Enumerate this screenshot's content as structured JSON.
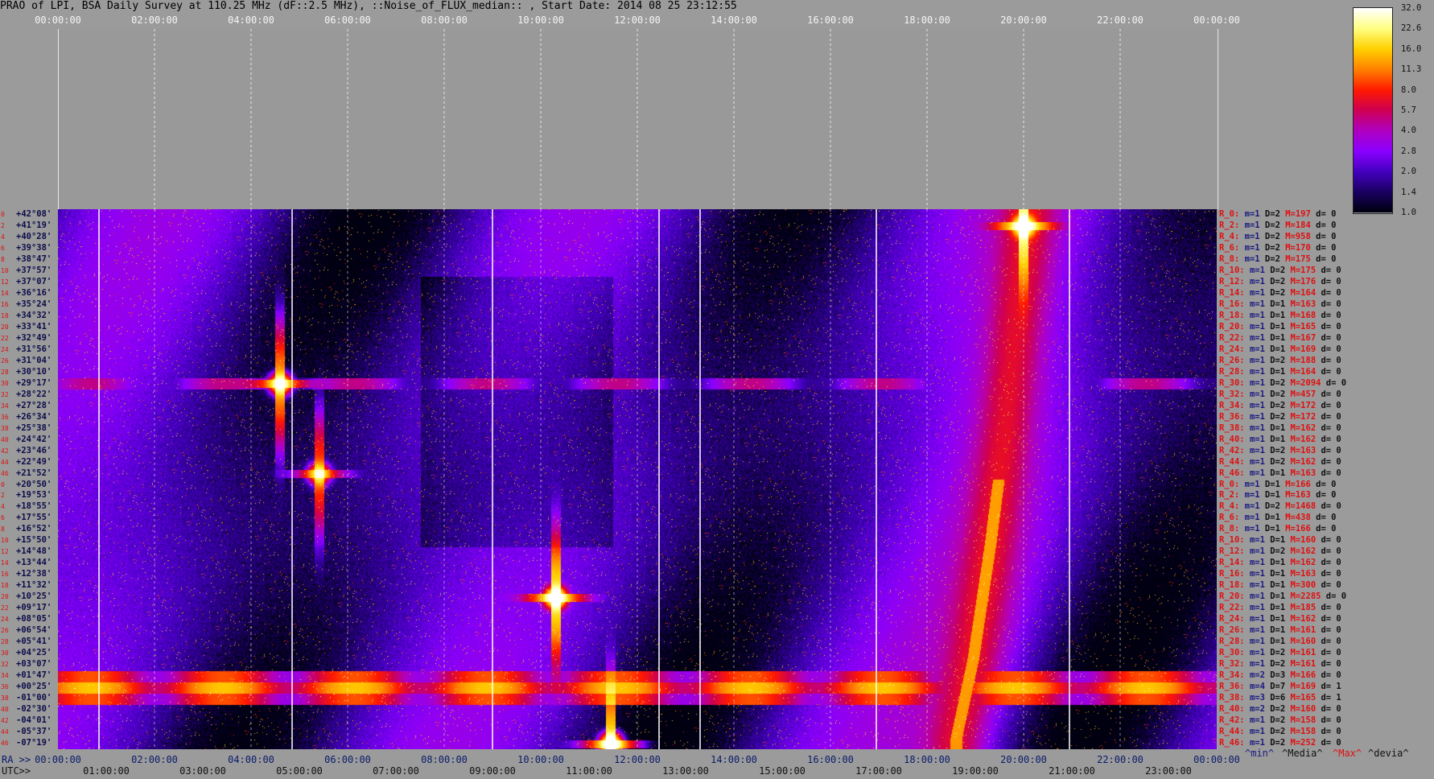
{
  "title": "PRAO of LPI, BSA Daily Survey at 110.25 MHz (dF::2.5 MHz), ::Noise_of_FLUX_median:: , Start Date: 2014 08 25 23:12:55",
  "axes": {
    "top_ticks": [
      "00:00:00",
      "02:00:00",
      "04:00:00",
      "06:00:00",
      "08:00:00",
      "10:00:00",
      "12:00:00",
      "14:00:00",
      "16:00:00",
      "18:00:00",
      "20:00:00",
      "22:00:00",
      "00:00:00"
    ],
    "ra_prefix": "RA >>",
    "ra_ticks": [
      "00:00:00",
      "02:00:00",
      "04:00:00",
      "06:00:00",
      "08:00:00",
      "10:00:00",
      "12:00:00",
      "14:00:00",
      "16:00:00",
      "18:00:00",
      "20:00:00",
      "22:00:00",
      "00:00:00"
    ],
    "utc_prefix": "UTC>>",
    "utc_ticks": [
      "01:00:00",
      "03:00:00",
      "05:00:00",
      "07:00:00",
      "09:00:00",
      "11:00:00",
      "13:00:00",
      "15:00:00",
      "17:00:00",
      "19:00:00",
      "21:00:00",
      "23:00:00"
    ]
  },
  "colorbar": {
    "ticks": [
      "32.0",
      "22.6",
      "16.0",
      "11.3",
      "8.0",
      "5.7",
      "4.0",
      "2.8",
      "2.0",
      "1.4",
      "1.0"
    ],
    "colors": [
      "#ffffff",
      "#ffff80",
      "#ffd000",
      "#ff8000",
      "#ff1a00",
      "#d00050",
      "#b000c0",
      "#8a00ff",
      "#4400c0",
      "#1a0060",
      "#000010"
    ]
  },
  "stats_legend": {
    "min": "^min^",
    "media": "^Media^",
    "max": "^Max^",
    "devia": "^devia^"
  },
  "declinations": [
    "+42°08'",
    "+41°19'",
    "+40°28'",
    "+39°38'",
    "+38°47'",
    "+37°57'",
    "+37°07'",
    "+36°16'",
    "+35°24'",
    "+34°32'",
    "+33°41'",
    "+32°49'",
    "+31°56'",
    "+31°04'",
    "+30°10'",
    "+29°17'",
    "+28°22'",
    "+27°28'",
    "+26°34'",
    "+25°38'",
    "+24°42'",
    "+23°46'",
    "+22°49'",
    "+21°52'",
    "+20°50'",
    "+19°53'",
    "+18°55'",
    "+17°55'",
    "+16°52'",
    "+15°50'",
    "+14°48'",
    "+13°44'",
    "+12°38'",
    "+11°32'",
    "+10°25'",
    "+09°17'",
    "+08°05'",
    "+06°54'",
    "+05°41'",
    "+04°25'",
    "+03°07'",
    "+01°47'",
    "+00°25'",
    "-01°00'",
    "-02°30'",
    "-04°01'",
    "-05°37'",
    "-07°19'"
  ],
  "beam_indices": [
    "0",
    "2",
    "4",
    "6",
    "8",
    "10",
    "12",
    "14",
    "16",
    "18",
    "20",
    "22",
    "24",
    "26",
    "28",
    "30",
    "32",
    "34",
    "36",
    "38",
    "40",
    "42",
    "44",
    "46",
    "0",
    "2",
    "4",
    "6",
    "8",
    "10",
    "12",
    "14",
    "16",
    "18",
    "20",
    "22",
    "24",
    "26",
    "28",
    "30",
    "32",
    "34",
    "36",
    "38",
    "40",
    "42",
    "44",
    "46"
  ],
  "beam_stats": [
    {
      "r": "R_0:",
      "m": "m=1",
      "d": "D=2",
      "M": "M=197",
      "z": "d= 0"
    },
    {
      "r": "R_2:",
      "m": "m=1",
      "d": "D=2",
      "M": "M=184",
      "z": "d= 0"
    },
    {
      "r": "R_4:",
      "m": "m=1",
      "d": "D=2",
      "M": "M=958",
      "z": "d= 0"
    },
    {
      "r": "R_6:",
      "m": "m=1",
      "d": "D=2",
      "M": "M=170",
      "z": "d= 0"
    },
    {
      "r": "R_8:",
      "m": "m=1",
      "d": "D=2",
      "M": "M=175",
      "z": "d= 0"
    },
    {
      "r": "R_10:",
      "m": "m=1",
      "d": "D=2",
      "M": "M=175",
      "z": "d= 0"
    },
    {
      "r": "R_12:",
      "m": "m=1",
      "d": "D=2",
      "M": "M=176",
      "z": "d= 0"
    },
    {
      "r": "R_14:",
      "m": "m=1",
      "d": "D=2",
      "M": "M=164",
      "z": "d= 0"
    },
    {
      "r": "R_16:",
      "m": "m=1",
      "d": "D=1",
      "M": "M=163",
      "z": "d= 0"
    },
    {
      "r": "R_18:",
      "m": "m=1",
      "d": "D=1",
      "M": "M=168",
      "z": "d= 0"
    },
    {
      "r": "R_20:",
      "m": "m=1",
      "d": "D=1",
      "M": "M=165",
      "z": "d= 0"
    },
    {
      "r": "R_22:",
      "m": "m=1",
      "d": "D=1",
      "M": "M=167",
      "z": "d= 0"
    },
    {
      "r": "R_24:",
      "m": "m=1",
      "d": "D=1",
      "M": "M=169",
      "z": "d= 0"
    },
    {
      "r": "R_26:",
      "m": "m=1",
      "d": "D=2",
      "M": "M=188",
      "z": "d= 0"
    },
    {
      "r": "R_28:",
      "m": "m=1",
      "d": "D=1",
      "M": "M=164",
      "z": "d= 0"
    },
    {
      "r": "R_30:",
      "m": "m=1",
      "d": "D=2",
      "M": "M=2094",
      "z": "d= 0"
    },
    {
      "r": "R_32:",
      "m": "m=1",
      "d": "D=2",
      "M": "M=457",
      "z": "d= 0"
    },
    {
      "r": "R_34:",
      "m": "m=1",
      "d": "D=2",
      "M": "M=172",
      "z": "d= 0"
    },
    {
      "r": "R_36:",
      "m": "m=1",
      "d": "D=2",
      "M": "M=172",
      "z": "d= 0"
    },
    {
      "r": "R_38:",
      "m": "m=1",
      "d": "D=1",
      "M": "M=162",
      "z": "d= 0"
    },
    {
      "r": "R_40:",
      "m": "m=1",
      "d": "D=1",
      "M": "M=162",
      "z": "d= 0"
    },
    {
      "r": "R_42:",
      "m": "m=1",
      "d": "D=2",
      "M": "M=163",
      "z": "d= 0"
    },
    {
      "r": "R_44:",
      "m": "m=1",
      "d": "D=2",
      "M": "M=162",
      "z": "d= 0"
    },
    {
      "r": "R_46:",
      "m": "m=1",
      "d": "D=1",
      "M": "M=163",
      "z": "d= 0"
    },
    {
      "r": "R_0:",
      "m": "m=1",
      "d": "D=1",
      "M": "M=166",
      "z": "d= 0"
    },
    {
      "r": "R_2:",
      "m": "m=1",
      "d": "D=1",
      "M": "M=163",
      "z": "d= 0"
    },
    {
      "r": "R_4:",
      "m": "m=1",
      "d": "D=2",
      "M": "M=1468",
      "z": "d= 0"
    },
    {
      "r": "R_6:",
      "m": "m=1",
      "d": "D=1",
      "M": "M=438",
      "z": "d= 0"
    },
    {
      "r": "R_8:",
      "m": "m=1",
      "d": "D=1",
      "M": "M=166",
      "z": "d= 0"
    },
    {
      "r": "R_10:",
      "m": "m=1",
      "d": "D=1",
      "M": "M=160",
      "z": "d= 0"
    },
    {
      "r": "R_12:",
      "m": "m=1",
      "d": "D=2",
      "M": "M=162",
      "z": "d= 0"
    },
    {
      "r": "R_14:",
      "m": "m=1",
      "d": "D=1",
      "M": "M=162",
      "z": "d= 0"
    },
    {
      "r": "R_16:",
      "m": "m=1",
      "d": "D=1",
      "M": "M=163",
      "z": "d= 0"
    },
    {
      "r": "R_18:",
      "m": "m=1",
      "d": "D=1",
      "M": "M=300",
      "z": "d= 0"
    },
    {
      "r": "R_20:",
      "m": "m=1",
      "d": "D=1",
      "M": "M=2285",
      "z": "d= 0"
    },
    {
      "r": "R_22:",
      "m": "m=1",
      "d": "D=1",
      "M": "M=185",
      "z": "d= 0"
    },
    {
      "r": "R_24:",
      "m": "m=1",
      "d": "D=1",
      "M": "M=162",
      "z": "d= 0"
    },
    {
      "r": "R_26:",
      "m": "m=1",
      "d": "D=1",
      "M": "M=161",
      "z": "d= 0"
    },
    {
      "r": "R_28:",
      "m": "m=1",
      "d": "D=1",
      "M": "M=160",
      "z": "d= 0"
    },
    {
      "r": "R_30:",
      "m": "m=1",
      "d": "D=2",
      "M": "M=161",
      "z": "d= 0"
    },
    {
      "r": "R_32:",
      "m": "m=1",
      "d": "D=2",
      "M": "M=161",
      "z": "d= 0"
    },
    {
      "r": "R_34:",
      "m": "m=2",
      "d": "D=3",
      "M": "M=166",
      "z": "d= 0"
    },
    {
      "r": "R_36:",
      "m": "m=4",
      "d": "D=7",
      "M": "M=169",
      "z": "d= 1"
    },
    {
      "r": "R_38:",
      "m": "m=3",
      "d": "D=6",
      "M": "M=165",
      "z": "d= 1"
    },
    {
      "r": "R_40:",
      "m": "m=2",
      "d": "D=2",
      "M": "M=160",
      "z": "d= 0"
    },
    {
      "r": "R_42:",
      "m": "m=1",
      "d": "D=2",
      "M": "M=158",
      "z": "d= 0"
    },
    {
      "r": "R_44:",
      "m": "m=1",
      "d": "D=2",
      "M": "M=158",
      "z": "d= 0"
    },
    {
      "r": "R_46:",
      "m": "m=1",
      "d": "D=2",
      "M": "M=252",
      "z": "d= 0"
    }
  ],
  "chart_data": {
    "type": "heatmap",
    "title": "PRAO of LPI, BSA Daily Survey at 110.25 MHz (dF::2.5 MHz), ::Noise_of_FLUX_median:: , Start Date: 2014 08 25 23:12:55",
    "xlabel": "RA / UTC",
    "ylabel": "",
    "x_range_hours": [
      0,
      24
    ],
    "rows": 48,
    "colorscale": [
      1.0,
      1.4,
      2.0,
      2.8,
      4.0,
      5.7,
      8.0,
      11.3,
      16.0,
      22.6,
      32.0
    ],
    "features": {
      "horizontal_bands": [
        {
          "rows": [
            41,
            43
          ],
          "from_h": 0,
          "to_h": 24,
          "level": 8.0
        },
        {
          "rows": [
            15,
            15
          ],
          "from_h": 0,
          "to_h": 24,
          "level": 4.0
        }
      ],
      "point_sources": [
        {
          "row": 34,
          "h": 10.3,
          "level": 32.0
        },
        {
          "row": 1,
          "h": 20.0,
          "level": 32.0
        },
        {
          "row": 47,
          "h": 11.45,
          "level": 32.0
        },
        {
          "row": 23,
          "h": 5.4,
          "level": 16.0
        },
        {
          "row": 15,
          "h": 4.6,
          "level": 22.6
        }
      ],
      "milky_way_ridge": [
        {
          "row": 47,
          "h": 18.6
        },
        {
          "row": 40,
          "h": 18.95
        },
        {
          "row": 30,
          "h": 19.3
        },
        {
          "row": 20,
          "h": 19.6
        },
        {
          "row": 10,
          "h": 19.85
        },
        {
          "row": 0,
          "h": 20.1
        }
      ],
      "vertical_lines_h": [
        0.85,
        4.85,
        9.0,
        12.45,
        13.3,
        16.95,
        20.95
      ]
    }
  }
}
